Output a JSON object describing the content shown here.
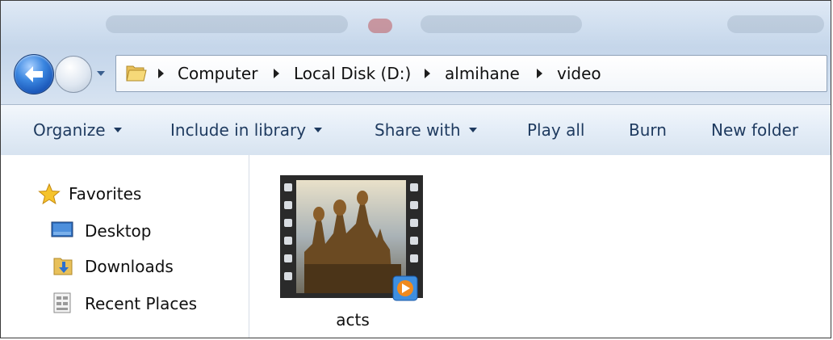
{
  "breadcrumbs": [
    "Computer",
    "Local Disk (D:)",
    "almihane",
    "video"
  ],
  "toolbar": {
    "organize": "Organize",
    "include_in_library": "Include in library",
    "share_with": "Share with",
    "play_all": "Play all",
    "burn": "Burn",
    "new_folder": "New folder"
  },
  "navigation": {
    "favorites": "Favorites",
    "desktop": "Desktop",
    "downloads": "Downloads",
    "recent_places": "Recent Places"
  },
  "files": [
    {
      "name": "acts",
      "icon": "video-thumbnail-icon"
    }
  ],
  "colors": {
    "toolbar_text": "#1e3a5f",
    "back_button": "#3a86e0"
  }
}
